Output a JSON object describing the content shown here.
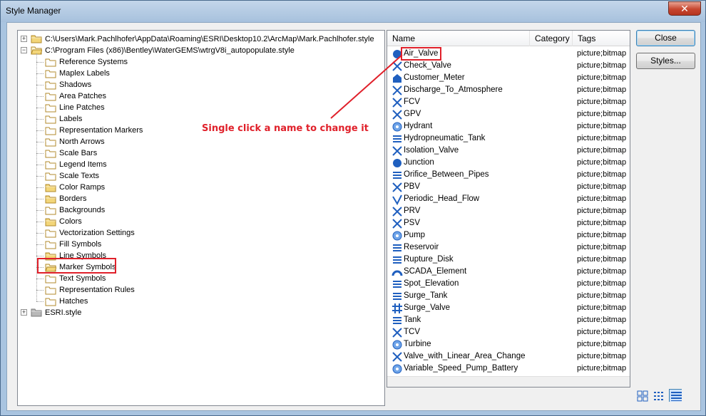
{
  "window": {
    "title": "Style Manager",
    "close_glyph": "✕"
  },
  "tree": {
    "root1": "C:\\Users\\Mark.Pachlhofer\\AppData\\Roaming\\ESRI\\Desktop10.2\\ArcMap\\Mark.Pachlhofer.style",
    "root2": "C:\\Program Files (x86)\\Bentley\\WaterGEMS\\wtrgV8i_autopopulate.style",
    "children": [
      "Reference Systems",
      "Maplex Labels",
      "Shadows",
      "Area Patches",
      "Line Patches",
      "Labels",
      "Representation Markers",
      "North Arrows",
      "Scale Bars",
      "Legend Items",
      "Scale Texts",
      "Color Ramps",
      "Borders",
      "Backgrounds",
      "Colors",
      "Vectorization Settings",
      "Fill Symbols",
      "Line Symbols",
      "Marker Symbols",
      "Text Symbols",
      "Representation Rules",
      "Hatches"
    ],
    "root3": "ESRI.style"
  },
  "list": {
    "columns": [
      "Name",
      "Category",
      "Tags"
    ],
    "rows": [
      {
        "name": "Air_Valve",
        "tags": "picture;bitmap"
      },
      {
        "name": "Check_Valve",
        "tags": "picture;bitmap"
      },
      {
        "name": "Customer_Meter",
        "tags": "picture;bitmap"
      },
      {
        "name": "Discharge_To_Atmosphere",
        "tags": "picture;bitmap"
      },
      {
        "name": "FCV",
        "tags": "picture;bitmap"
      },
      {
        "name": "GPV",
        "tags": "picture;bitmap"
      },
      {
        "name": "Hydrant",
        "tags": "picture;bitmap"
      },
      {
        "name": "Hydropneumatic_Tank",
        "tags": "picture;bitmap"
      },
      {
        "name": "Isolation_Valve",
        "tags": "picture;bitmap"
      },
      {
        "name": "Junction",
        "tags": "picture;bitmap"
      },
      {
        "name": "Orifice_Between_Pipes",
        "tags": "picture;bitmap"
      },
      {
        "name": "PBV",
        "tags": "picture;bitmap"
      },
      {
        "name": "Periodic_Head_Flow",
        "tags": "picture;bitmap"
      },
      {
        "name": "PRV",
        "tags": "picture;bitmap"
      },
      {
        "name": "PSV",
        "tags": "picture;bitmap"
      },
      {
        "name": "Pump",
        "tags": "picture;bitmap"
      },
      {
        "name": "Reservoir",
        "tags": "picture;bitmap"
      },
      {
        "name": "Rupture_Disk",
        "tags": "picture;bitmap"
      },
      {
        "name": "SCADA_Element",
        "tags": "picture;bitmap"
      },
      {
        "name": "Spot_Elevation",
        "tags": "picture;bitmap"
      },
      {
        "name": "Surge_Tank",
        "tags": "picture;bitmap"
      },
      {
        "name": "Surge_Valve",
        "tags": "picture;bitmap"
      },
      {
        "name": "Tank",
        "tags": "picture;bitmap"
      },
      {
        "name": "TCV",
        "tags": "picture;bitmap"
      },
      {
        "name": "Turbine",
        "tags": "picture;bitmap"
      },
      {
        "name": "Valve_with_Linear_Area_Change",
        "tags": "picture;bitmap"
      },
      {
        "name": "Variable_Speed_Pump_Battery",
        "tags": "picture;bitmap"
      }
    ]
  },
  "buttons": {
    "close": "Close",
    "styles": "Styles..."
  },
  "annotation": {
    "text": "Single click a name to change it",
    "color": "#e0202a"
  },
  "colors": {
    "accent": "#e0202a",
    "icon_blue": "#1f5fbf",
    "folder": "#f3d67a"
  }
}
